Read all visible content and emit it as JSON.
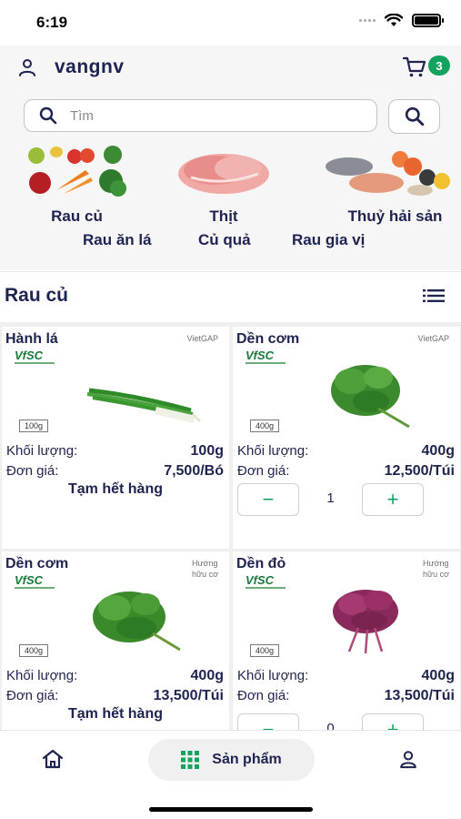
{
  "status_bar": {
    "time": "6:19"
  },
  "header": {
    "username": "vangnv",
    "cart_count": "3"
  },
  "search": {
    "placeholder": "Tìm"
  },
  "categories": {
    "main": [
      {
        "label": "Rau củ",
        "icon": "vegetables-image"
      },
      {
        "label": "Thịt",
        "icon": "meat-image"
      },
      {
        "label": "Thuỷ hải sản",
        "icon": "seafood-image"
      }
    ],
    "sub": [
      "Rau ăn lá",
      "Củ quả",
      "Rau gia vị"
    ]
  },
  "section": {
    "title": "Rau củ"
  },
  "labels": {
    "weight": "Khối lượng:",
    "price": "Đơn giá:",
    "out_of_stock": "Tạm hết hàng",
    "brand": "VfSC"
  },
  "products": [
    {
      "name": "Hành lá",
      "tag1": "VietGAP",
      "tag2": "",
      "pack": "100g",
      "weight": "100g",
      "price": "7,500/Bó",
      "status": "Tạm hết hàng",
      "quantity": ""
    },
    {
      "name": "Dền cơm",
      "tag1": "VietGAP",
      "tag2": "",
      "pack": "400g",
      "weight": "400g",
      "price": "12,500/Túi",
      "status": "",
      "quantity": "1"
    },
    {
      "name": "Dền cơm",
      "tag1": "Hướng",
      "tag2": "hữu cơ",
      "pack": "400g",
      "weight": "400g",
      "price": "13,500/Túi",
      "status": "Tạm hết hàng",
      "quantity": ""
    },
    {
      "name": "Dền đỏ",
      "tag1": "Hướng",
      "tag2": "hữu cơ",
      "pack": "400g",
      "weight": "400g",
      "price": "13,500/Túi",
      "status": "",
      "quantity": "0"
    }
  ],
  "stepper": {
    "minus": "−",
    "plus": "+"
  },
  "bottom_nav": {
    "products_label": "Sản phẩm"
  },
  "colors": {
    "accent": "#14a35f",
    "text": "#1e2350",
    "panel": "#f6f6f6"
  }
}
